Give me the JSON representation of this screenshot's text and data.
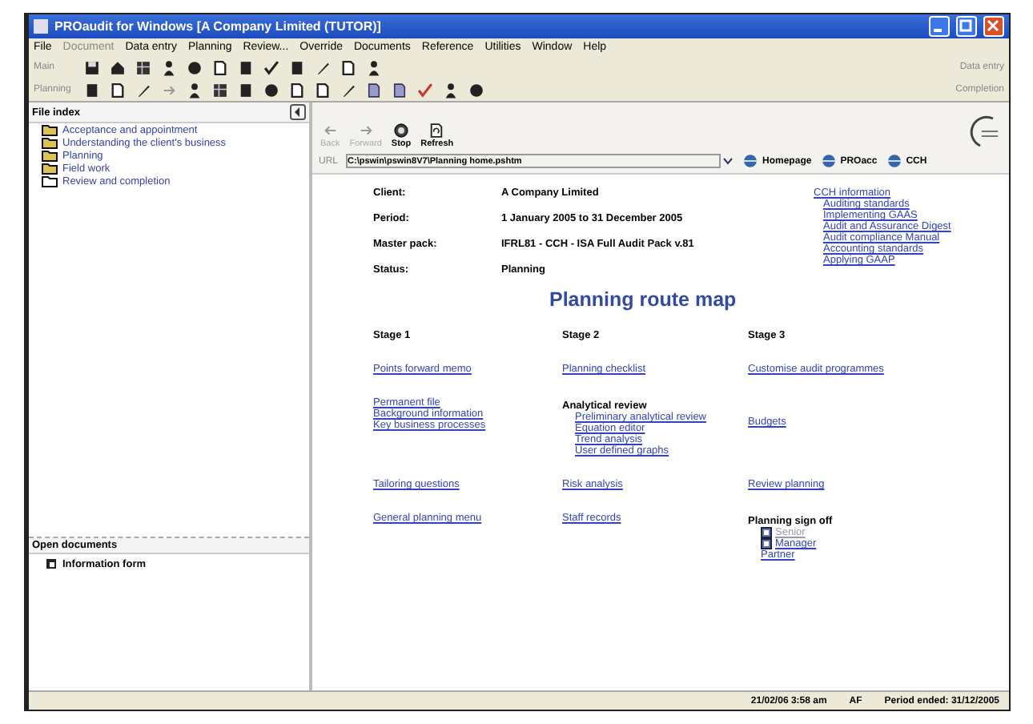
{
  "window": {
    "title": "PROaudit for Windows [A Company Limited (TUTOR)]"
  },
  "menu": [
    {
      "label": "File",
      "disabled": false
    },
    {
      "label": "Document",
      "disabled": true
    },
    {
      "label": "Data entry",
      "disabled": false
    },
    {
      "label": "Planning",
      "disabled": false
    },
    {
      "label": "Review...",
      "disabled": false
    },
    {
      "label": "Override",
      "disabled": false
    },
    {
      "label": "Documents",
      "disabled": false
    },
    {
      "label": "Reference",
      "disabled": false
    },
    {
      "label": "Utilities",
      "disabled": false
    },
    {
      "label": "Window",
      "disabled": false
    },
    {
      "label": "Help",
      "disabled": false
    }
  ],
  "toolbars": [
    {
      "label": "Main",
      "right_label": "Data entry"
    },
    {
      "label": "Planning",
      "right_label": "Completion"
    }
  ],
  "file_index": {
    "title": "File index",
    "items": [
      {
        "label": "Acceptance and appointment",
        "filled": true
      },
      {
        "label": "Understanding the client's business",
        "filled": true
      },
      {
        "label": "Planning",
        "filled": true
      },
      {
        "label": "Field work",
        "filled": true
      },
      {
        "label": "Review and completion",
        "filled": false
      }
    ]
  },
  "open_documents": {
    "title": "Open documents",
    "items": [
      {
        "label": "Information form"
      }
    ]
  },
  "browser": {
    "buttons": [
      {
        "label": "Back",
        "disabled": true
      },
      {
        "label": "Forward",
        "disabled": true
      },
      {
        "label": "Stop",
        "disabled": false
      },
      {
        "label": "Refresh",
        "disabled": false
      }
    ],
    "url_label": "URL",
    "url": "C:\\pswin\\pswin8V7\\Planning home.pshtm",
    "links": [
      "Homepage",
      "PROacc",
      "CCH"
    ]
  },
  "client_info": [
    {
      "label": "Client:",
      "value": "A Company Limited"
    },
    {
      "label": "Period:",
      "value": "1 January 2005 to 31 December 2005"
    },
    {
      "label": "Master pack:",
      "value": "IFRL81 - CCH - ISA Full Audit Pack v.81"
    },
    {
      "label": "Status:",
      "value": "Planning"
    }
  ],
  "cch_links": {
    "title": "CCH information",
    "items": [
      "Auditing standards",
      "Implementing GAAS",
      "Audit and Assurance Digest",
      "Audit compliance Manual",
      "Accounting standards",
      "Applying GAAP"
    ]
  },
  "route_map": {
    "title": "Planning route map",
    "stages": [
      "Stage 1",
      "Stage 2",
      "Stage 3"
    ],
    "rows": [
      [
        [
          {
            "kind": "link",
            "label": "Points forward memo"
          }
        ],
        [
          {
            "kind": "link",
            "label": "Planning checklist"
          }
        ],
        [
          {
            "kind": "link",
            "label": "Customise audit programmes"
          }
        ]
      ],
      [
        [
          {
            "kind": "link",
            "label": "Permanent file"
          },
          {
            "kind": "link",
            "label": "Background information"
          },
          {
            "kind": "link",
            "label": "Key business processes"
          }
        ],
        [
          {
            "kind": "heading",
            "label": "Analytical review"
          },
          {
            "kind": "sublink",
            "label": "Preliminary analytical review"
          },
          {
            "kind": "sublink",
            "label": "Equation editor"
          },
          {
            "kind": "sublink",
            "label": "Trend analysis"
          },
          {
            "kind": "sublink",
            "label": "User defined graphs"
          }
        ],
        [
          {
            "kind": "spacer_link",
            "label": "Budgets"
          }
        ]
      ],
      [
        [
          {
            "kind": "link",
            "label": "Tailoring questions"
          }
        ],
        [
          {
            "kind": "link",
            "label": "Risk analysis"
          }
        ],
        [
          {
            "kind": "link",
            "label": "Review planning"
          }
        ]
      ],
      [
        [
          {
            "kind": "link",
            "label": "General planning menu"
          }
        ],
        [
          {
            "kind": "link",
            "label": "Staff records"
          }
        ],
        [
          {
            "kind": "heading",
            "label": "Planning sign off"
          },
          {
            "kind": "signoff",
            "label": "Senior",
            "disabled": true,
            "icon": true
          },
          {
            "kind": "signoff",
            "label": "Manager",
            "disabled": false,
            "icon": true
          },
          {
            "kind": "signoff",
            "label": "Partner",
            "disabled": false,
            "icon": false
          }
        ]
      ]
    ]
  },
  "status_bar": {
    "date": "21/02/06 3:58 am",
    "user": "AF",
    "period": "Period ended: 31/12/2005"
  }
}
